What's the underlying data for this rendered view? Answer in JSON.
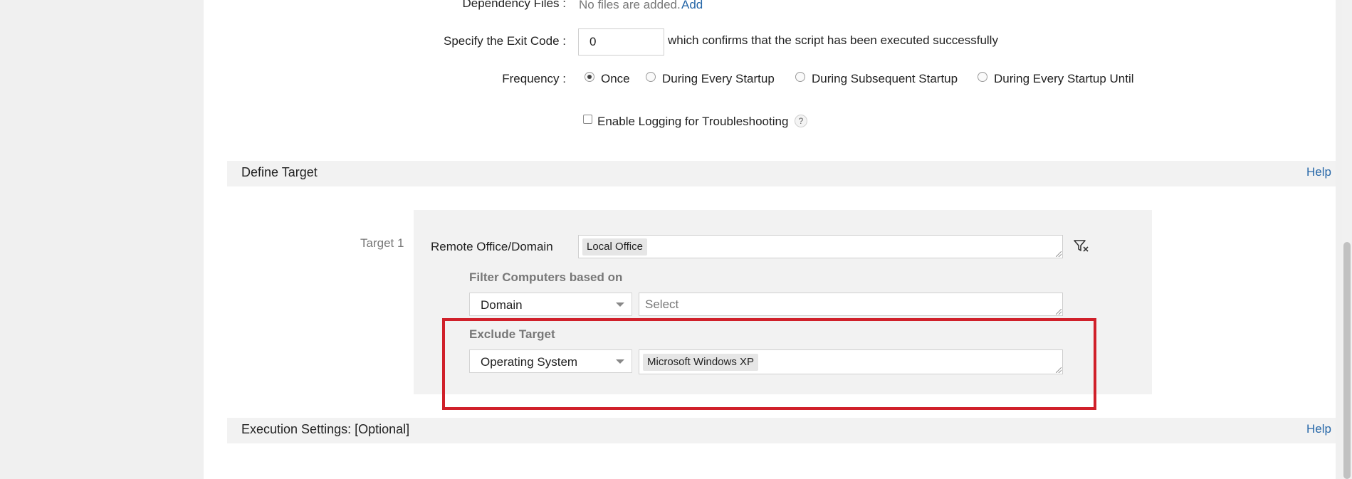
{
  "form": {
    "dependency_label": "Dependency Files :",
    "dependency_value": "No files are added.",
    "dependency_add": "Add",
    "exit_code_label": "Specify the Exit Code :",
    "exit_code_value": "0",
    "exit_code_hint": "which confirms that the script has been executed successfully",
    "frequency_label": "Frequency :",
    "frequency_options": [
      {
        "label": "Once",
        "checked": true
      },
      {
        "label": "During Every Startup",
        "checked": false
      },
      {
        "label": "During Subsequent Startup",
        "checked": false
      },
      {
        "label": "During Every Startup Until",
        "checked": false
      }
    ],
    "logging_label": "Enable Logging for Troubleshooting",
    "logging_checked": false,
    "help_q": "?"
  },
  "define_target": {
    "title": "Define Target",
    "help": "Help",
    "target_label": "Target 1",
    "remote_label": "Remote Office/Domain",
    "remote_chip": "Local Office",
    "filter_label": "Filter Computers based on",
    "filter_select": "Domain",
    "filter_placeholder": "Select",
    "exclude_label": "Exclude Target",
    "exclude_select": "Operating System",
    "exclude_chip": "Microsoft Windows XP"
  },
  "execution": {
    "title": "Execution Settings: [Optional]",
    "help": "Help"
  },
  "colors": {
    "accent_link": "#2667a8",
    "highlight": "#d0202a",
    "panel_bg": "#f2f2f2"
  }
}
